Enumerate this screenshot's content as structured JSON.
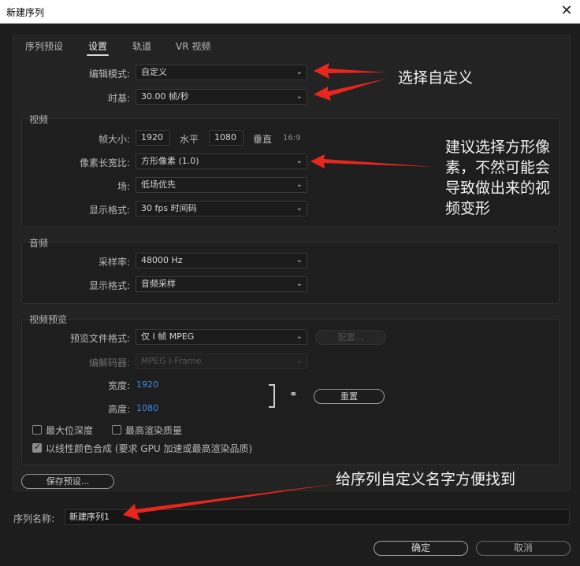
{
  "window": {
    "title": "新建序列",
    "close_glyph": "✕"
  },
  "tabs": [
    {
      "label": "序列预设",
      "active": false
    },
    {
      "label": "设置",
      "active": true
    },
    {
      "label": "轨道",
      "active": false
    },
    {
      "label": "VR 视频",
      "active": false
    }
  ],
  "top": {
    "editing_mode_label": "编辑模式:",
    "editing_mode_value": "自定义",
    "timebase_label": "时基:",
    "timebase_value": "30.00  帧/秒"
  },
  "video": {
    "section_title": "视频",
    "frame_size_label": "帧大小:",
    "frame_width": "1920",
    "horizontal_label": "水平",
    "frame_height": "1080",
    "vertical_label": "垂直",
    "aspect_ratio": "16:9",
    "pixel_aspect_label": "像素长宽比:",
    "pixel_aspect_value": "方形像素 (1.0)",
    "fields_label": "场:",
    "fields_value": "低场优先",
    "display_format_label": "显示格式:",
    "display_format_value": "30 fps 时间码"
  },
  "audio": {
    "section_title": "音频",
    "sample_rate_label": "采样率:",
    "sample_rate_value": "48000 Hz",
    "display_format_label": "显示格式:",
    "display_format_value": "音频采样"
  },
  "preview": {
    "section_title": "视频预览",
    "file_format_label": "预览文件格式:",
    "file_format_value": "仅 I 帧 MPEG",
    "configure_button": "配置...",
    "codec_label": "编解码器:",
    "codec_value": "MPEG I-Frame",
    "width_label": "宽度:",
    "width_value": "1920",
    "height_label": "高度:",
    "height_value": "1080",
    "reset_button": "重置",
    "max_bit_depth": {
      "label": "最大位深度",
      "checked": false
    },
    "max_render_quality": {
      "label": "最高渲染质量",
      "checked": false
    },
    "linear_color": {
      "label": "以线性颜色合成 (要求 GPU 加速或最高渲染品质)",
      "checked": true
    }
  },
  "save_preset_button": "保存预设...",
  "sequence_name": {
    "label": "序列名称:",
    "value": "新建序列1"
  },
  "ok_button": "确定",
  "cancel_button": "取消",
  "annotations": {
    "custom": "选择自定义",
    "square_pixels": [
      "建议选择方形像",
      "素，不然可能会",
      "导致做出来的视",
      "频变形"
    ],
    "name": "给序列自定义名字方便找到"
  },
  "colors": {
    "arrow": "#e8261e",
    "link": "#3b8eea",
    "background": "#1d1d1d"
  },
  "icons": [
    "close-icon",
    "chevron-down-icon",
    "link-icon",
    "checkmark-icon"
  ]
}
